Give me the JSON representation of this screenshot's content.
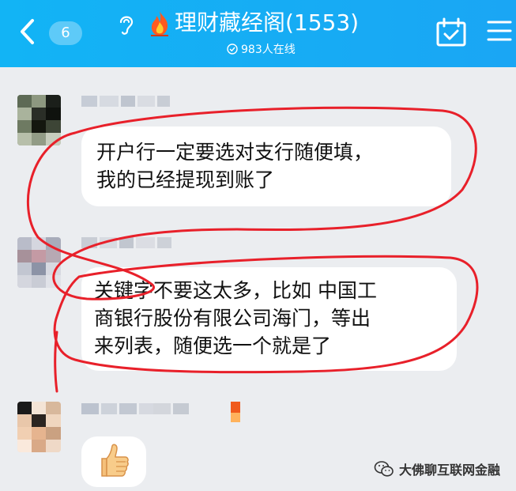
{
  "header": {
    "unread_count": "6",
    "title": "理财藏经阁(1553)",
    "online_text": "983人在线",
    "colors": {
      "bar": "#15aff5",
      "text": "#ffffff"
    },
    "icons": [
      "back-chevron-icon",
      "ear-icon",
      "fire-icon",
      "calendar-check-icon",
      "menu-icon"
    ]
  },
  "messages": [
    {
      "lines": [
        "开户行一定要选对支行随便填，",
        "我的已经提现到账了"
      ]
    },
    {
      "lines": [
        "关键字不要这太多，比如 中国工",
        "商银行股份有限公司海门，等出",
        "来列表，随便选一个就是了"
      ]
    },
    {
      "emoji": "thumbs-up"
    }
  ],
  "watermark": {
    "text": "大佛聊互联网金融"
  },
  "annotation_color": "#e8202a"
}
